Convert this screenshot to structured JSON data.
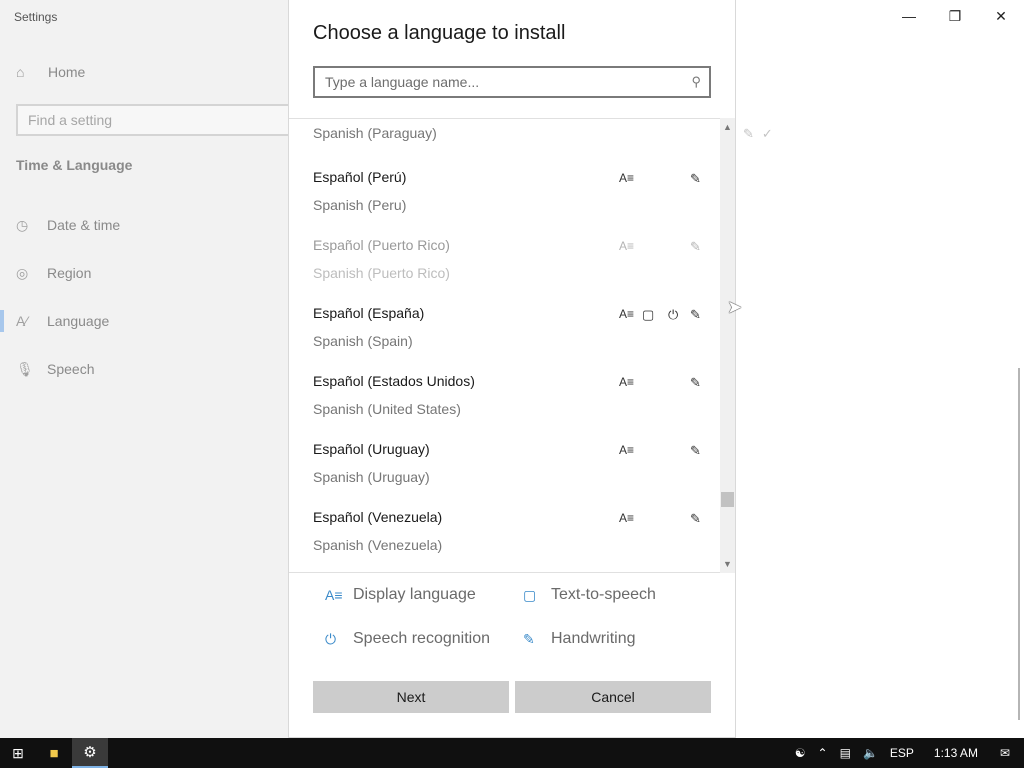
{
  "settings": {
    "app_title": "Settings",
    "home_label": "Home",
    "search_placeholder": "Find a setting",
    "section_title": "Time & Language",
    "nav": [
      {
        "label": "Date & time",
        "icon": "calendar-clock-icon"
      },
      {
        "label": "Region",
        "icon": "globe-icon"
      },
      {
        "label": "Language",
        "icon": "language-icon"
      },
      {
        "label": "Speech",
        "icon": "microphone-icon"
      }
    ],
    "active_nav": "Language"
  },
  "dialog": {
    "title": "Choose a language to install",
    "search_placeholder": "Type a language name...",
    "languages": [
      {
        "native": "",
        "english": "Spanish (Paraguay)",
        "disabled": false,
        "features": []
      },
      {
        "native": "Español (Perú)",
        "english": "Spanish (Peru)",
        "disabled": false,
        "features": [
          "display",
          "handwriting"
        ]
      },
      {
        "native": "Español (Puerto Rico)",
        "english": "Spanish (Puerto Rico)",
        "disabled": true,
        "features": [
          "display",
          "handwriting"
        ]
      },
      {
        "native": "Español (España)",
        "english": "Spanish (Spain)",
        "disabled": false,
        "features": [
          "display",
          "tts",
          "speech",
          "handwriting"
        ]
      },
      {
        "native": "Español (Estados Unidos)",
        "english": "Spanish (United States)",
        "disabled": false,
        "features": [
          "display",
          "handwriting"
        ]
      },
      {
        "native": "Español (Uruguay)",
        "english": "Spanish (Uruguay)",
        "disabled": false,
        "features": [
          "display",
          "handwriting"
        ]
      },
      {
        "native": "Español (Venezuela)",
        "english": "Spanish (Venezuela)",
        "disabled": false,
        "features": [
          "display",
          "handwriting"
        ]
      }
    ],
    "legend": {
      "display_language": "Display language",
      "text_to_speech": "Text-to-speech",
      "speech_recognition": "Speech recognition",
      "handwriting": "Handwriting"
    },
    "buttons": {
      "next": "Next",
      "cancel": "Cancel"
    }
  },
  "taskbar": {
    "input_language": "ESP",
    "time": "1:13 AM"
  },
  "colors": {
    "accent": "#3a8ac9",
    "taskbar": "#101010",
    "sidebar": "#f2f2f2",
    "button": "#cccccc"
  }
}
